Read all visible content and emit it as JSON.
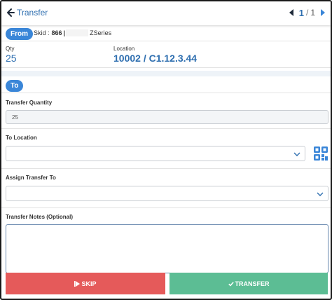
{
  "header": {
    "title": "Transfer",
    "pager": {
      "current": "1",
      "separator": "/",
      "total": "1"
    }
  },
  "from": {
    "badge": "From",
    "skid_label": "Skid :",
    "skid_number": "866",
    "skid_separator": "|",
    "series": "ZSeries",
    "qty_label": "Qty",
    "qty_value": "25",
    "location_label": "Location",
    "location_value": "10002 / C1.12.3.44"
  },
  "to": {
    "badge": "To",
    "transfer_quantity_label": "Transfer Quantity",
    "transfer_quantity_value": "25",
    "to_location_label": "To Location",
    "to_location_value": "",
    "assign_label": "Assign Transfer To",
    "assign_value": "",
    "notes_label": "Transfer Notes (Optional)",
    "notes_value": ""
  },
  "actions": {
    "skip_label": "SKIP",
    "transfer_label": "TRANSFER"
  },
  "colors": {
    "accent": "#2f6fb0",
    "badge": "#3a86d8",
    "skip": "#e55a5a",
    "transfer": "#5cbd94"
  },
  "icons": {
    "back": "arrow-left-icon",
    "prev": "caret-left-icon",
    "next": "caret-right-icon",
    "dropdown": "chevron-down-icon",
    "scan": "qr-code-icon",
    "skip": "skip-icon",
    "transfer": "check-icon"
  }
}
